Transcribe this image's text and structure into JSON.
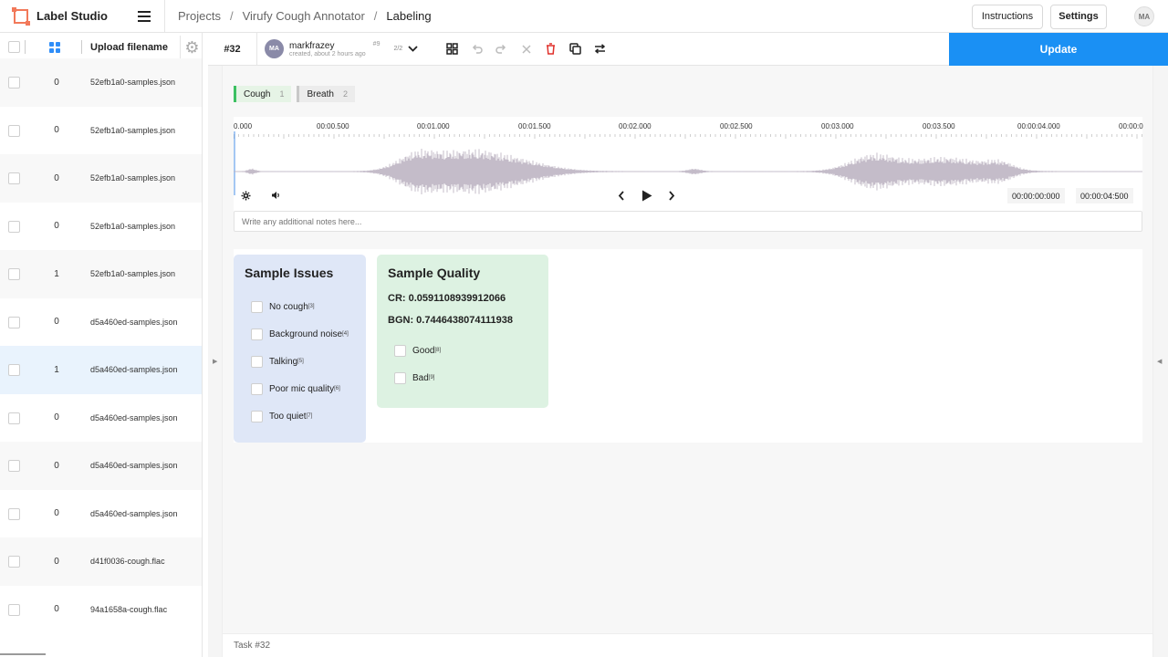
{
  "app": {
    "name": "Label Studio"
  },
  "breadcrumb": [
    "Projects",
    "Virufy Cough Annotator",
    "Labeling"
  ],
  "header": {
    "instructions": "Instructions",
    "settings": "Settings",
    "user_initials": "MA"
  },
  "task_list": {
    "column_title": "Upload filename",
    "rows": [
      {
        "count": "0",
        "filename": "52efb1a0-samples.json"
      },
      {
        "count": "0",
        "filename": "52efb1a0-samples.json"
      },
      {
        "count": "0",
        "filename": "52efb1a0-samples.json"
      },
      {
        "count": "0",
        "filename": "52efb1a0-samples.json"
      },
      {
        "count": "1",
        "filename": "52efb1a0-samples.json"
      },
      {
        "count": "0",
        "filename": "d5a460ed-samples.json"
      },
      {
        "count": "1",
        "filename": "d5a460ed-samples.json"
      },
      {
        "count": "0",
        "filename": "d5a460ed-samples.json"
      },
      {
        "count": "0",
        "filename": "d5a460ed-samples.json"
      },
      {
        "count": "0",
        "filename": "d5a460ed-samples.json"
      },
      {
        "count": "0",
        "filename": "d41f0036-cough.flac"
      },
      {
        "count": "0",
        "filename": "94a1658a-cough.flac"
      }
    ]
  },
  "toolbar": {
    "task_id": "#32",
    "annotator_initials": "MA",
    "annotator_name": "markfrazey",
    "annotation_num": "#9",
    "created": "created, about 2 hours ago",
    "pages": "2/2",
    "update": "Update"
  },
  "labels": [
    {
      "name": "Cough",
      "hotkey": "1",
      "color": "#3cc062"
    },
    {
      "name": "Breath",
      "hotkey": "2",
      "color": "#c8c8c8"
    }
  ],
  "timeline": {
    "ticks": [
      "0.000",
      "00:00.500",
      "00:01.000",
      "00:01.500",
      "00:02.000",
      "00:02.500",
      "00:03.000",
      "00:03.500",
      "00:00:04.000",
      "00:00:0"
    ]
  },
  "player": {
    "current_time": "00:00:00:000",
    "duration": "00:00:04:500"
  },
  "notes": {
    "placeholder": "Write any additional notes here..."
  },
  "sample_issues": {
    "title": "Sample Issues",
    "choices": [
      {
        "label": "No cough",
        "hotkey": "[3]"
      },
      {
        "label": "Background noise",
        "hotkey": "[4]"
      },
      {
        "label": "Talking",
        "hotkey": "[5]"
      },
      {
        "label": "Poor mic quality",
        "hotkey": "[6]"
      },
      {
        "label": "Too quiet",
        "hotkey": "[7]"
      }
    ]
  },
  "sample_quality": {
    "title": "Sample Quality",
    "cr": "CR: 0.0591108939912066",
    "bgn": "BGN: 0.7446438074111938",
    "choices": [
      {
        "label": "Good",
        "hotkey": "[8]"
      },
      {
        "label": "Bad",
        "hotkey": "[9]"
      }
    ]
  },
  "footer": {
    "task": "Task #32"
  }
}
